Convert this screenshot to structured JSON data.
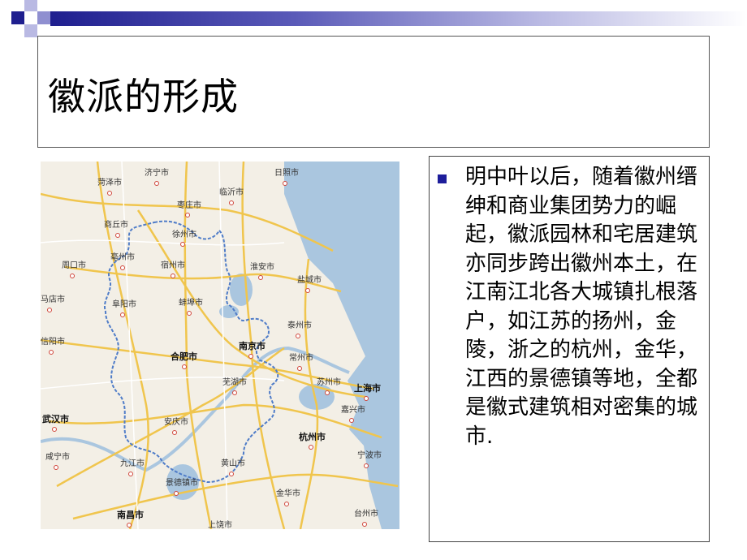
{
  "slide": {
    "title": "徽派的形成",
    "body": "明中叶以后，随着徽州缙绅和商业集团势力的崛起，徽派园林和宅居建筑亦同步跨出徽州本土，在江南江北各大城镇扎根落户，如江苏的扬州，金陵，浙之的杭州，金华，江西的景德镇等地，全都是徽式建筑相对密集的城市.",
    "accent_color": "#1d1d9b"
  },
  "map": {
    "cities": [
      {
        "name": "菏泽市",
        "big": false
      },
      {
        "name": "济宁市",
        "big": false
      },
      {
        "name": "日照市",
        "big": false
      },
      {
        "name": "枣庄市",
        "big": false
      },
      {
        "name": "临沂市",
        "big": false
      },
      {
        "name": "商丘市",
        "big": false
      },
      {
        "name": "徐州市",
        "big": false
      },
      {
        "name": "亳州市",
        "big": false
      },
      {
        "name": "宿州市",
        "big": false
      },
      {
        "name": "淮安市",
        "big": false
      },
      {
        "name": "周口市",
        "big": false
      },
      {
        "name": "盐城市",
        "big": false
      },
      {
        "name": "马店市",
        "big": false
      },
      {
        "name": "阜阳市",
        "big": false
      },
      {
        "name": "蚌埠市",
        "big": false
      },
      {
        "name": "泰州市",
        "big": false
      },
      {
        "name": "信阳市",
        "big": false
      },
      {
        "name": "合肥市",
        "big": true
      },
      {
        "name": "南京市",
        "big": true
      },
      {
        "name": "常州市",
        "big": false
      },
      {
        "name": "芜湖市",
        "big": false
      },
      {
        "name": "苏州市",
        "big": false
      },
      {
        "name": "上海市",
        "big": true
      },
      {
        "name": "嘉兴市",
        "big": false
      },
      {
        "name": "武汉市",
        "big": true
      },
      {
        "name": "安庆市",
        "big": false
      },
      {
        "name": "杭州市",
        "big": true
      },
      {
        "name": "咸宁市",
        "big": false
      },
      {
        "name": "九江市",
        "big": false
      },
      {
        "name": "黄山市",
        "big": false
      },
      {
        "name": "宁波市",
        "big": false
      },
      {
        "name": "景德镇市",
        "big": false
      },
      {
        "name": "金华市",
        "big": false
      },
      {
        "name": "南昌市",
        "big": true
      },
      {
        "name": "台州市",
        "big": false
      },
      {
        "name": "上饶市",
        "big": false
      }
    ]
  }
}
